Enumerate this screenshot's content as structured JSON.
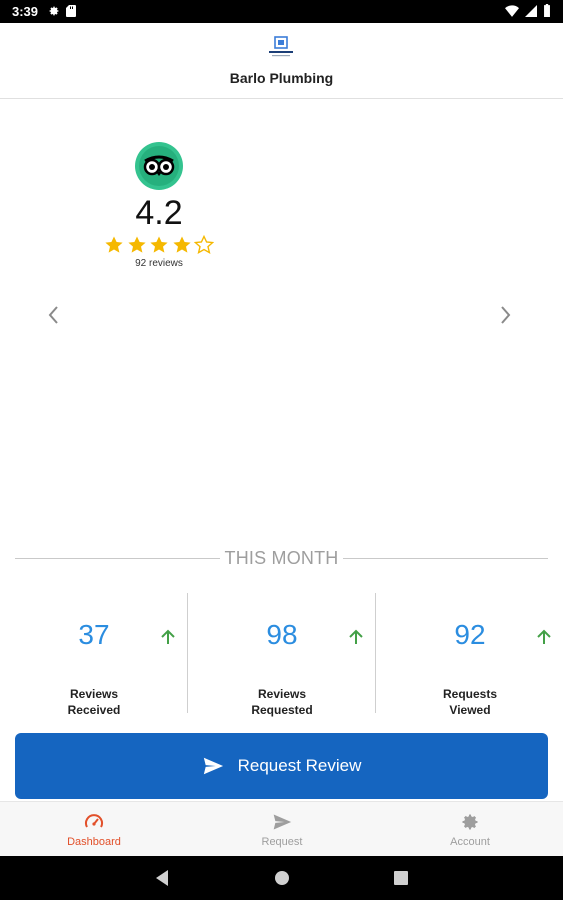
{
  "status_bar": {
    "time": "3:39",
    "left_icons": [
      "gear-icon",
      "sd-card-icon"
    ],
    "right_icons": [
      "wifi-icon",
      "signal-icon",
      "battery-icon"
    ]
  },
  "header": {
    "logo_icon": "barlo-plumbing-logo",
    "business_name": "Barlo Plumbing"
  },
  "rating": {
    "provider_icon": "tripadvisor-logo",
    "value": "4.2",
    "stars_filled": 4,
    "stars_total": 5,
    "review_count": "92 reviews",
    "star_color": "#f5b800"
  },
  "carousel": {
    "prev_icon": "chevron-left-icon",
    "next_icon": "chevron-right-icon"
  },
  "section": {
    "label": "THIS MONTH"
  },
  "stats": [
    {
      "value": "37",
      "label_line1": "Reviews",
      "label_line2": "Received",
      "trend": "up"
    },
    {
      "value": "98",
      "label_line1": "Reviews",
      "label_line2": "Requested",
      "trend": "up"
    },
    {
      "value": "92",
      "label_line1": "Requests",
      "label_line2": "Viewed",
      "trend": "up"
    }
  ],
  "colors": {
    "stat_value": "#2b8de0",
    "trend_up": "#43a047",
    "primary_button": "#1565c0",
    "nav_active": "#e2502a",
    "nav_inactive": "#9e9e9e"
  },
  "primary_action": {
    "label": "Request Review",
    "icon": "send-icon"
  },
  "bottom_nav": [
    {
      "label": "Dashboard",
      "icon": "dashboard-gauge-icon",
      "active": true
    },
    {
      "label": "Request",
      "icon": "send-icon",
      "active": false
    },
    {
      "label": "Account",
      "icon": "gear-icon",
      "active": false
    }
  ],
  "system_nav": [
    "back-icon",
    "home-icon",
    "recents-icon"
  ]
}
